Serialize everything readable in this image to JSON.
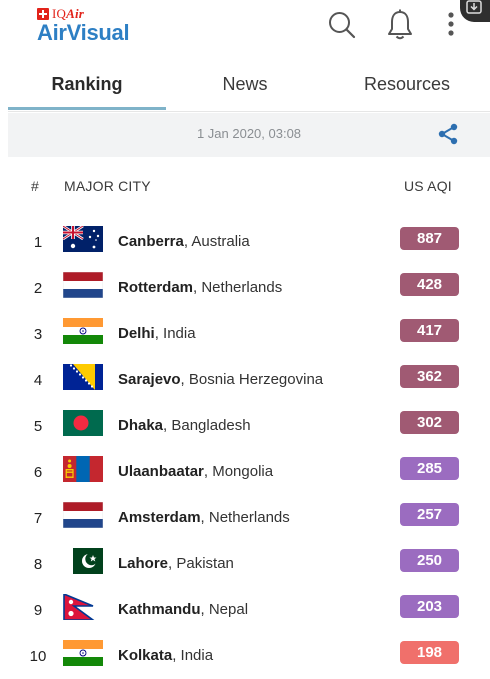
{
  "brand": {
    "iq_prefix": "IQ",
    "iq_suffix": "Air",
    "name": "AirVisual"
  },
  "header_icons": [
    "search-icon",
    "bell-icon",
    "more-vertical-icon"
  ],
  "tabs": [
    {
      "label": "Ranking",
      "active": true
    },
    {
      "label": "News",
      "active": false
    },
    {
      "label": "Resources",
      "active": false
    }
  ],
  "date": "1 Jan 2020, 03:08",
  "columns": {
    "rank": "#",
    "city": "MAJOR CITY",
    "aqi": "US AQI"
  },
  "colors": {
    "brand_blue": "#2d7fc4",
    "iq_red": "#e2231a",
    "aqi_hazardous": "#a05a73",
    "aqi_very_unhealthy": "#9b6cc0",
    "aqi_unhealthy": "#f0706b",
    "tab_underline": "#7fb3c9"
  },
  "rankings": [
    {
      "rank": "1",
      "city": "Canberra",
      "country": "Australia",
      "aqi": "887",
      "flag": "australia",
      "color": "#a05a73"
    },
    {
      "rank": "2",
      "city": "Rotterdam",
      "country": "Netherlands",
      "aqi": "428",
      "flag": "netherlands",
      "color": "#a05a73"
    },
    {
      "rank": "3",
      "city": "Delhi",
      "country": "India",
      "aqi": "417",
      "flag": "india",
      "color": "#a05a73"
    },
    {
      "rank": "4",
      "city": "Sarajevo",
      "country": "Bosnia Herzegovina",
      "aqi": "362",
      "flag": "bosnia",
      "color": "#a05a73"
    },
    {
      "rank": "5",
      "city": "Dhaka",
      "country": "Bangladesh",
      "aqi": "302",
      "flag": "bangladesh",
      "color": "#a05a73"
    },
    {
      "rank": "6",
      "city": "Ulaanbaatar",
      "country": "Mongolia",
      "aqi": "285",
      "flag": "mongolia",
      "color": "#9b6cc0"
    },
    {
      "rank": "7",
      "city": "Amsterdam",
      "country": "Netherlands",
      "aqi": "257",
      "flag": "netherlands",
      "color": "#9b6cc0"
    },
    {
      "rank": "8",
      "city": "Lahore",
      "country": "Pakistan",
      "aqi": "250",
      "flag": "pakistan",
      "color": "#9b6cc0"
    },
    {
      "rank": "9",
      "city": "Kathmandu",
      "country": "Nepal",
      "aqi": "203",
      "flag": "nepal",
      "color": "#9b6cc0"
    },
    {
      "rank": "10",
      "city": "Kolkata",
      "country": "India",
      "aqi": "198",
      "flag": "india",
      "color": "#f0706b"
    }
  ]
}
